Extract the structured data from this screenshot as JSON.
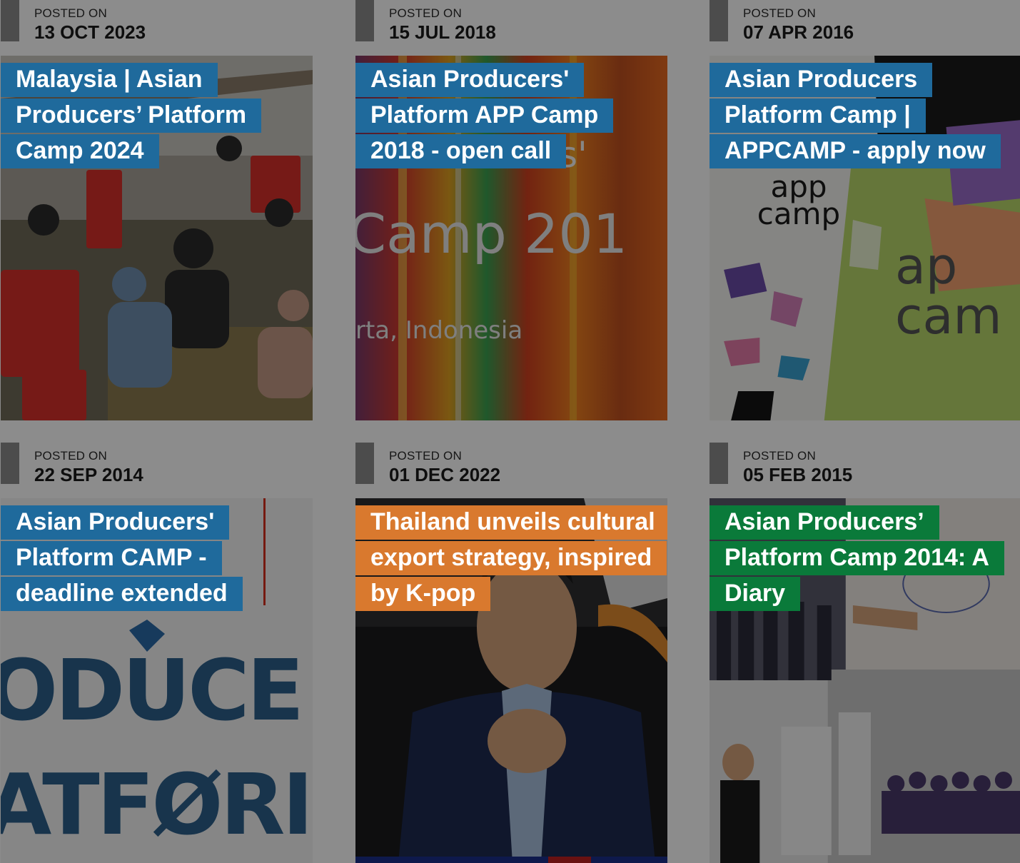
{
  "posts": [
    {
      "posted_label": "POSTED ON",
      "date": "13 OCT 2023",
      "title": "Malaysia | Asian Producers’ Platform Camp 2024",
      "title_color": "#1f6a9c",
      "image": "photo-workshop-group"
    },
    {
      "posted_label": "POSTED ON",
      "date": "15 JUL 2018",
      "title": "Asian Producers' Platform APP Camp 2018 - open call",
      "title_color": "#1f6a9c",
      "image": "poster-camp-2018",
      "image_text": {
        "line1": "Camp 201",
        "line2": "rta, Indonesia",
        "line3": "s'"
      }
    },
    {
      "posted_label": "POSTED ON",
      "date": "07 APR 2016",
      "title": "Asian Producers Platform Camp | APPCAMP - apply now",
      "title_color": "#1f6a9c",
      "image": "app-camp-booklets",
      "image_text": {
        "logo1": "app camp",
        "logo2": "ap cam"
      }
    },
    {
      "posted_label": "POSTED ON",
      "date": "22 SEP 2014",
      "title": "Asian Producers' Platform CAMP - deadline extended",
      "title_color": "#1f6a9c",
      "image": "poster-producers-platform",
      "image_text": {
        "line1": "ODUCE",
        "line2": "ATFØRI"
      }
    },
    {
      "posted_label": "POSTED ON",
      "date": "01 DEC 2022",
      "title": "Thailand unveils cultural export strategy, inspired by K-pop",
      "title_color": "#d9792e",
      "image": "photo-man-speaking"
    },
    {
      "posted_label": "POSTED ON",
      "date": "05 FEB 2015",
      "title": "Asian Producers’ Platform Camp 2014: A Diary",
      "title_color": "#0a7a3a",
      "image": "photo-collage-diary"
    }
  ]
}
